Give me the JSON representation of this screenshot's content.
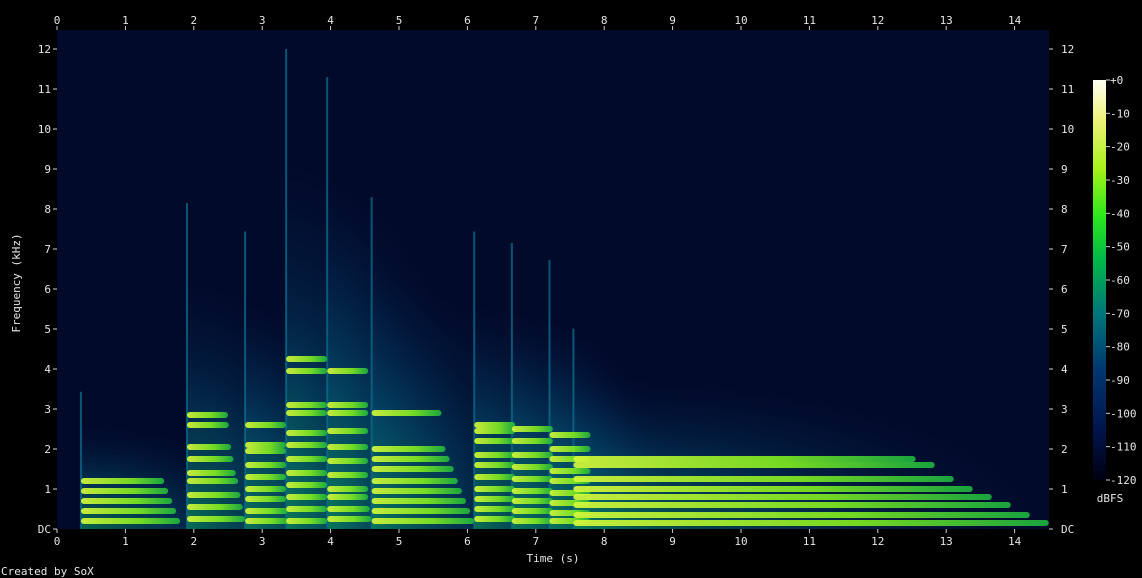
{
  "chart_data": {
    "type": "heatmap",
    "xlabel": "Time (s)",
    "ylabel": "Frequency (kHz)",
    "xlim": [
      0,
      14.5
    ],
    "ylim": [
      0,
      12
    ],
    "x_ticks": [
      "0",
      "1",
      "2",
      "3",
      "4",
      "5",
      "6",
      "7",
      "8",
      "9",
      "10",
      "11",
      "12",
      "13",
      "14"
    ],
    "y_ticks": [
      "DC",
      "1",
      "2",
      "3",
      "4",
      "5",
      "6",
      "7",
      "8",
      "9",
      "10",
      "11",
      "12"
    ],
    "colorbar": {
      "label": "dBFS",
      "ticks": [
        "+0",
        "-10",
        "-20",
        "-30",
        "-40",
        "-50",
        "-60",
        "-70",
        "-80",
        "-90",
        "-100",
        "-110",
        "-120"
      ]
    },
    "notes": [
      {
        "onset_s": 0.35,
        "end_s": 1.8,
        "partials_khz": [
          0.2,
          0.45,
          0.7,
          0.95,
          1.2
        ]
      },
      {
        "onset_s": 1.9,
        "end_s": 2.75,
        "partials_khz": [
          0.25,
          0.55,
          0.85,
          1.2,
          1.4,
          1.75,
          2.05,
          2.6,
          2.85
        ]
      },
      {
        "onset_s": 2.75,
        "end_s": 3.4,
        "partials_khz": [
          0.2,
          0.45,
          0.75,
          1.0,
          1.3,
          1.6,
          1.95,
          2.1,
          2.6
        ]
      },
      {
        "onset_s": 3.35,
        "end_s": 3.95,
        "partials_khz": [
          0.2,
          0.5,
          0.8,
          1.1,
          1.4,
          1.75,
          2.1,
          2.4,
          2.9,
          3.1,
          3.95,
          4.25
        ]
      },
      {
        "onset_s": 3.95,
        "end_s": 4.6,
        "partials_khz": [
          0.25,
          0.5,
          0.8,
          1.0,
          1.35,
          1.7,
          2.05,
          2.45,
          2.9,
          3.1,
          3.95
        ]
      },
      {
        "onset_s": 4.6,
        "end_s": 6.1,
        "partials_khz": [
          0.2,
          0.45,
          0.7,
          0.95,
          1.2,
          1.5,
          1.75,
          2.0,
          2.9
        ]
      },
      {
        "onset_s": 6.1,
        "end_s": 6.65,
        "partials_khz": [
          0.25,
          0.5,
          0.75,
          1.0,
          1.3,
          1.6,
          1.85,
          2.2,
          2.45,
          2.6
        ]
      },
      {
        "onset_s": 6.65,
        "end_s": 7.2,
        "partials_khz": [
          0.2,
          0.45,
          0.7,
          0.95,
          1.25,
          1.55,
          1.85,
          2.2,
          2.5
        ]
      },
      {
        "onset_s": 7.2,
        "end_s": 7.55,
        "partials_khz": [
          0.2,
          0.4,
          0.65,
          0.9,
          1.2,
          1.45,
          1.75,
          2.0,
          2.35
        ]
      },
      {
        "onset_s": 7.55,
        "end_s": 14.5,
        "partials_khz": [
          0.15,
          0.35,
          0.6,
          0.8,
          1.0,
          1.25,
          1.6,
          1.75
        ]
      }
    ]
  },
  "footer": {
    "credit": "Created by SoX"
  }
}
